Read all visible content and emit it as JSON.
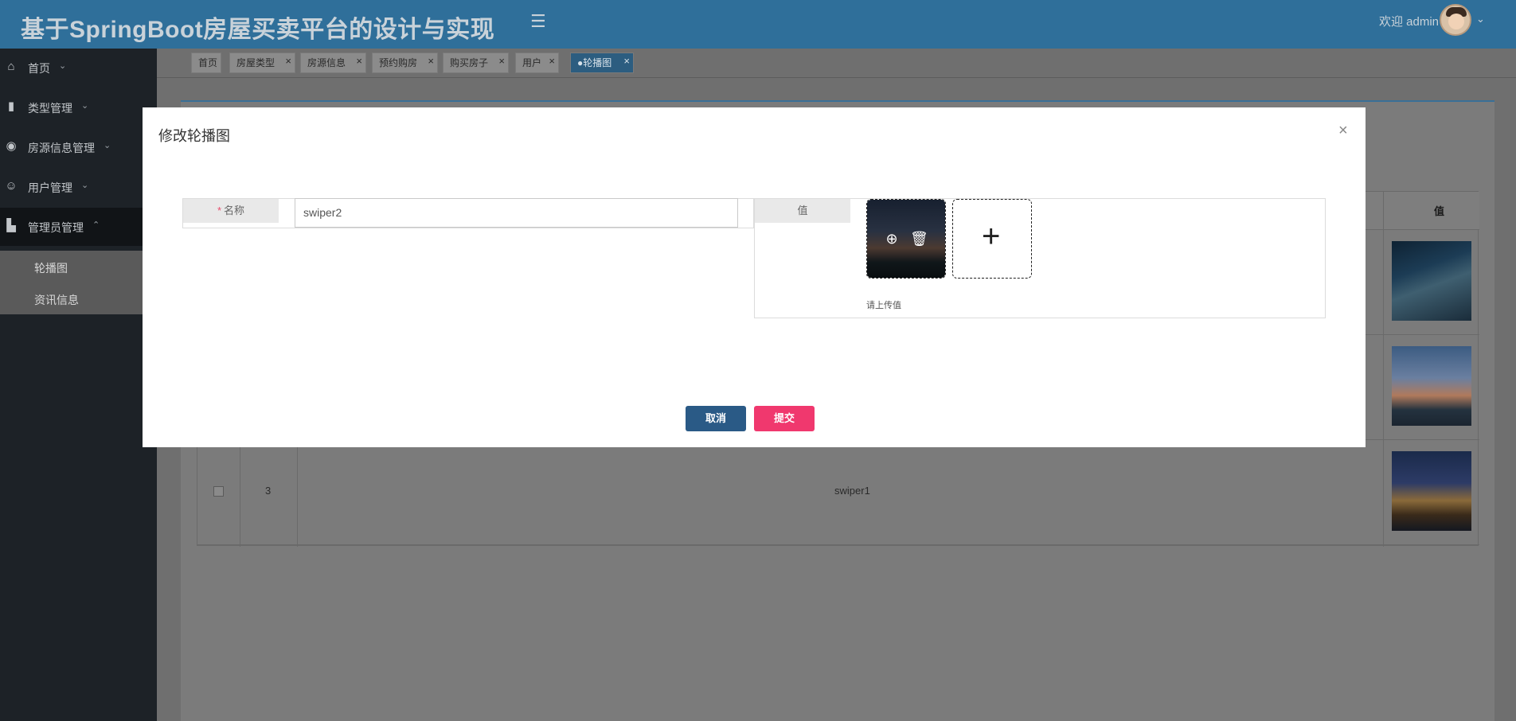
{
  "header": {
    "title": "基于SpringBoot房屋买卖平台的设计与实现",
    "menu_icon": "hamburger-icon",
    "welcome": "欢迎 admin"
  },
  "sidebar": {
    "items": [
      {
        "label": "首页",
        "icon": "home-icon",
        "chevron": "⌄"
      },
      {
        "label": "类型管理",
        "icon": "book-icon",
        "chevron": "⌄"
      },
      {
        "label": "房源信息管理",
        "icon": "compass-icon",
        "chevron": "⌄"
      },
      {
        "label": "用户管理",
        "icon": "user-icon",
        "chevron": "⌄"
      },
      {
        "label": "管理员管理",
        "icon": "admin-icon",
        "chevron": "⌃"
      }
    ],
    "subitems": [
      {
        "label": "轮播图"
      },
      {
        "label": "资讯信息"
      }
    ]
  },
  "tabs": [
    {
      "label": "首页"
    },
    {
      "label": "房屋类型"
    },
    {
      "label": "房源信息"
    },
    {
      "label": "预约购房"
    },
    {
      "label": "购买房子"
    },
    {
      "label": "用户"
    },
    {
      "label": "●轮播图",
      "active": true
    }
  ],
  "table": {
    "value_header": "值",
    "rows": [
      {
        "index": "3",
        "name": "swiper1"
      }
    ]
  },
  "modal": {
    "title": "修改轮播图",
    "close": "×",
    "name_label": "名称",
    "required_mark": "*",
    "name_value": "swiper2",
    "value_label": "值",
    "upload_hint": "请上传值",
    "cancel_label": "取消",
    "submit_label": "提交"
  },
  "colors": {
    "header": "#2f6f9a",
    "sidebar": "#1d2227",
    "cancel_button": "#2a5a86",
    "submit_button": "#f0386e"
  }
}
